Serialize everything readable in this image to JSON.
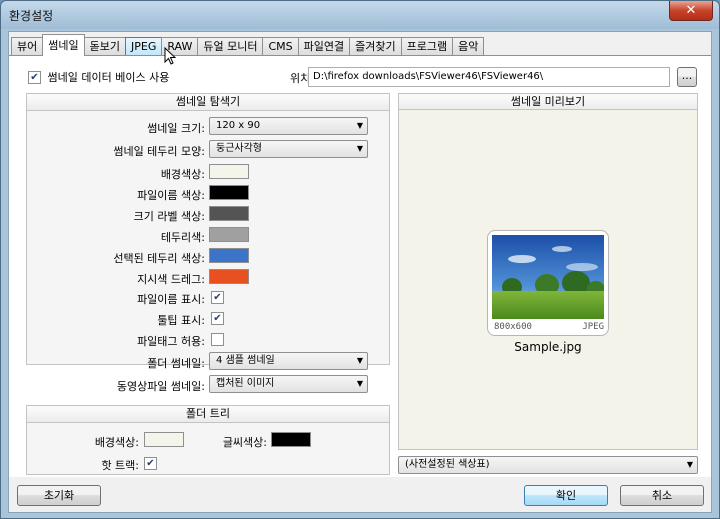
{
  "window": {
    "title": "환경설정",
    "close_label": "✕"
  },
  "tabs": [
    {
      "label": "뷰어",
      "state": "normal"
    },
    {
      "label": "썸네일",
      "state": "active"
    },
    {
      "label": "돋보기",
      "state": "normal"
    },
    {
      "label": "JPEG",
      "state": "hover"
    },
    {
      "label": "RAW",
      "state": "normal"
    },
    {
      "label": "듀얼 모니터",
      "state": "normal"
    },
    {
      "label": "CMS",
      "state": "normal"
    },
    {
      "label": "파일연결",
      "state": "normal"
    },
    {
      "label": "즐겨찾기",
      "state": "normal"
    },
    {
      "label": "프로그램",
      "state": "normal"
    },
    {
      "label": "음악",
      "state": "normal"
    }
  ],
  "thumb_db": {
    "label": "썸네일 데이터 베이스 사용",
    "checked": true
  },
  "location": {
    "label": "위치:",
    "value": "D:\\firefox downloads\\FSViewer46\\FSViewer46\\",
    "browse_label": "..."
  },
  "explorer": {
    "header": "썸네일 탐색기",
    "size": {
      "label": "썸네일 크기:",
      "value": "120 x 90"
    },
    "border_shape": {
      "label": "썸네일 테두리 모양:",
      "value": "둥근사각형"
    },
    "bg_color": {
      "label": "배경색상:",
      "color": "#f4f4ea"
    },
    "filename_color": {
      "label": "파일이름 색상:",
      "color": "#000000"
    },
    "size_label_color": {
      "label": "크기 라벨 색상:",
      "color": "#545454"
    },
    "border_color": {
      "label": "테두리색:",
      "color": "#a0a0a0"
    },
    "selected_border_color": {
      "label": "선택된 테두리 색상:",
      "color": "#3b74c9"
    },
    "drag_color": {
      "label": "지시색 드레그:",
      "color": "#e8501f"
    },
    "show_filename": {
      "label": "파일이름 표시:",
      "checked": true
    },
    "show_tooltip": {
      "label": "툴팁 표시:",
      "checked": true
    },
    "allow_filetag": {
      "label": "파일태그 허용:",
      "checked": false
    },
    "folder_thumb": {
      "label": "폴더 썸네일:",
      "value": "4 샘플 썸네일"
    },
    "video_thumb": {
      "label": "동영상파일 썸네일:",
      "value": "캡처된 이미지"
    }
  },
  "folder_tree": {
    "header": "폴더 트리",
    "bg_color": {
      "label": "배경색상:",
      "color": "#f4f4ea"
    },
    "text_color": {
      "label": "글씨색상:",
      "color": "#000000"
    },
    "hot_track": {
      "label": "핫 트랙:",
      "checked": true
    }
  },
  "preview": {
    "header": "썸네일 미리보기",
    "image_size": "800x600",
    "image_format": "JPEG",
    "file_name": "Sample.jpg",
    "preset": "(사전설정된 색상표)"
  },
  "buttons": {
    "reset": "초기화",
    "ok": "확인",
    "cancel": "취소"
  }
}
